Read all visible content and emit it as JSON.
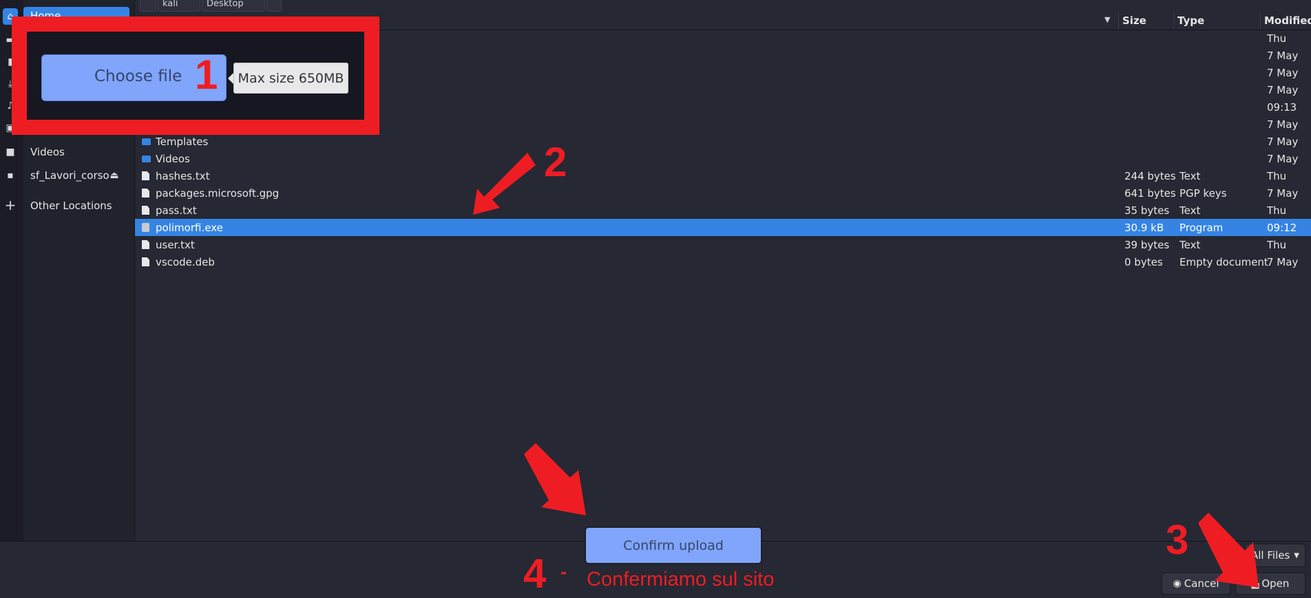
{
  "toolbar": {
    "crumbs": [
      "kali",
      "Desktop"
    ]
  },
  "sidebar": {
    "items": [
      {
        "label": "Home",
        "icon": "home-icon"
      },
      {
        "label": "Videos",
        "icon": "video-camera-icon"
      },
      {
        "label": "sf_Lavori_corso",
        "icon": "drive-icon",
        "eject": "eject-icon"
      },
      {
        "label": "Other Locations",
        "icon": "plus-icon"
      }
    ]
  },
  "columns": {
    "size": "Size",
    "type": "Type",
    "modified": "Modified"
  },
  "files": [
    {
      "name": "",
      "size": "",
      "type": "",
      "modified": "Thu"
    },
    {
      "name": "",
      "size": "",
      "type": "",
      "modified": "7 May"
    },
    {
      "name": "",
      "size": "",
      "type": "",
      "modified": "7 May"
    },
    {
      "name": "",
      "size": "",
      "type": "",
      "modified": "7 May"
    },
    {
      "name": "",
      "size": "",
      "type": "",
      "modified": "09:13"
    },
    {
      "name": "",
      "size": "",
      "type": "",
      "modified": "7 May"
    },
    {
      "name": "Templates",
      "size": "",
      "type": "",
      "modified": "7 May",
      "kind": "folder"
    },
    {
      "name": "Videos",
      "size": "",
      "type": "",
      "modified": "7 May",
      "kind": "folder"
    },
    {
      "name": "hashes.txt",
      "size": "244 bytes",
      "type": "Text",
      "modified": "Thu",
      "kind": "file"
    },
    {
      "name": "packages.microsoft.gpg",
      "size": "641 bytes",
      "type": "PGP keys",
      "modified": "7 May",
      "kind": "file"
    },
    {
      "name": "pass.txt",
      "size": "35 bytes",
      "type": "Text",
      "modified": "Thu",
      "kind": "file"
    },
    {
      "name": "polimorfi.exe",
      "size": "30.9 kB",
      "type": "Program",
      "modified": "09:12",
      "kind": "exe",
      "selected": true
    },
    {
      "name": "user.txt",
      "size": "39 bytes",
      "type": "Text",
      "modified": "Thu",
      "kind": "file"
    },
    {
      "name": "vscode.deb",
      "size": "0 bytes",
      "type": "Empty document",
      "modified": "7 May",
      "kind": "file"
    }
  ],
  "filter": {
    "label": "All Files"
  },
  "buttons": {
    "cancel": "Cancel",
    "open": "Open"
  },
  "overlay": {
    "choose_file": "Choose file",
    "max_size": "Max size 650MB",
    "confirm_upload": "Confirm upload",
    "step1": "1",
    "step2": "2",
    "step3": "3",
    "step4": "4",
    "step4_dash": "-",
    "step4_text": "Confermiamo sul sito"
  },
  "colors": {
    "accent": "#3584e4",
    "annotation": "#ee1d23",
    "site_button": "#80a5fa"
  }
}
